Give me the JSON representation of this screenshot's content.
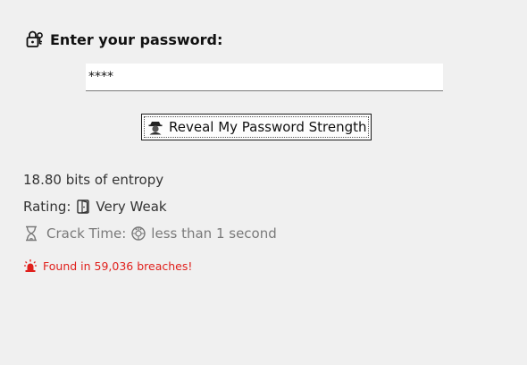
{
  "form": {
    "heading": "Enter your password:",
    "password_value": "****",
    "reveal_button_label": "Reveal My Password Strength"
  },
  "results": {
    "entropy_text": "18.80 bits of entropy",
    "rating_label": "Rating:",
    "rating_value": "Very Weak",
    "crack_label": "Crack Time:",
    "crack_value": "less than 1 second",
    "breach_text": "Found in 59,036 breaches!"
  },
  "icons": {
    "heading": "lock-with-key-icon",
    "reveal_button": "detective-icon",
    "rating": "door-icon",
    "crack_lead": "hourglass-icon",
    "crack_value": "turtle-icon",
    "breach": "siren-icon"
  },
  "colors": {
    "background": "#f0f0f0",
    "alert": "#e0201c",
    "muted": "#7a7a7a"
  }
}
